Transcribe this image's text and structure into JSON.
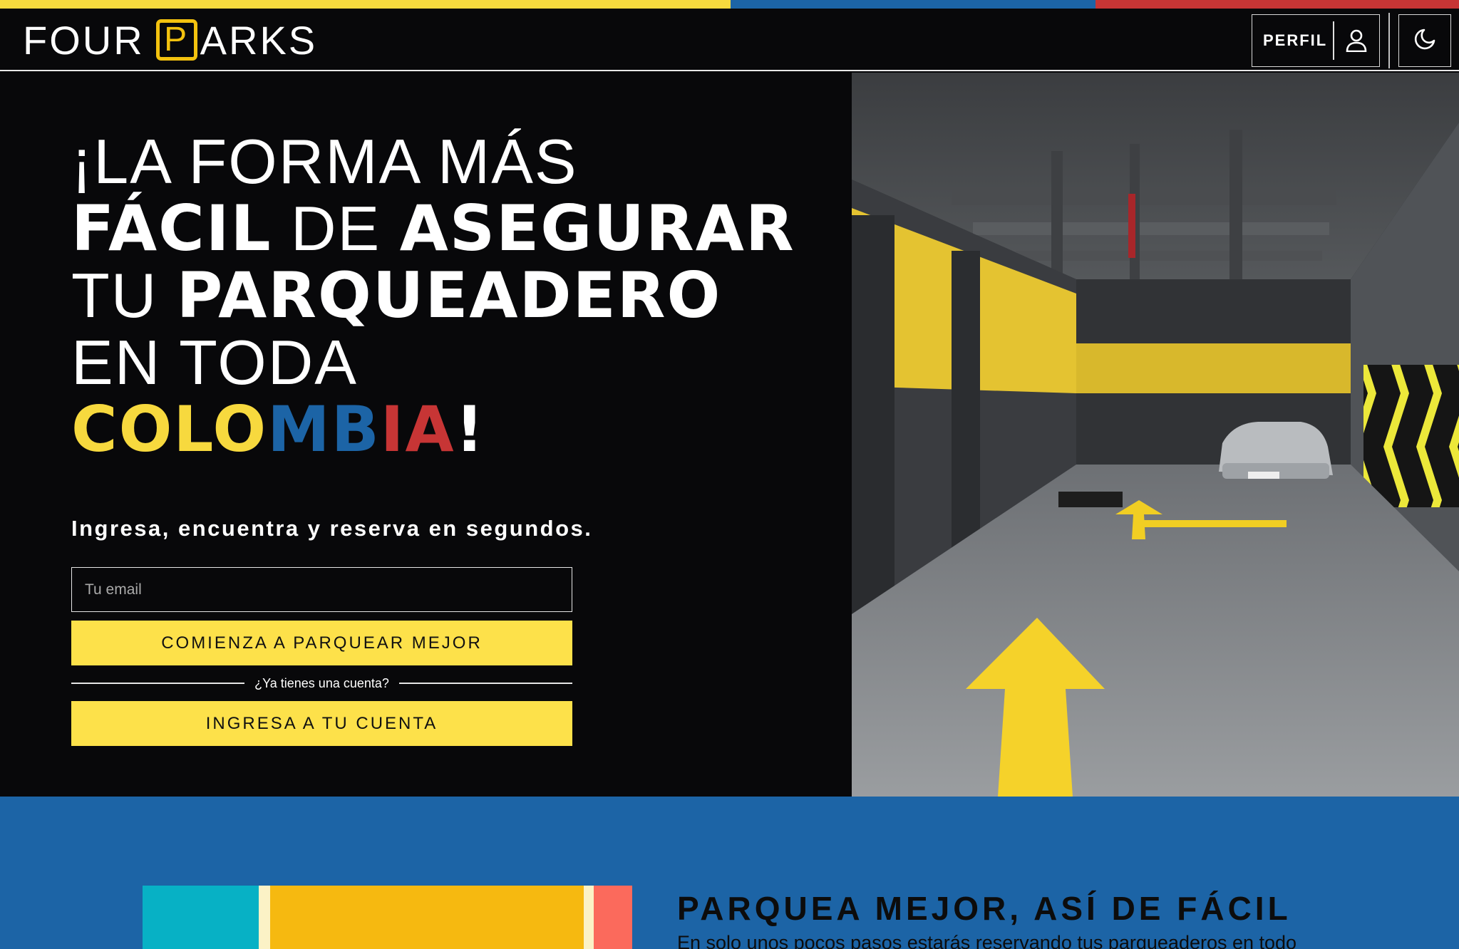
{
  "brand": {
    "logo_left": "FOUR",
    "logo_p": "P",
    "logo_right": "ARKS",
    "colors": {
      "yellow": "#f7d93e",
      "blue": "#1c64a6",
      "red": "#c73535",
      "background": "#08080a",
      "button": "#fde14a"
    }
  },
  "header": {
    "profile_label": "PERFIL",
    "profile_icon": "user-icon",
    "theme_icon": "moon-icon"
  },
  "hero": {
    "line1": "¡LA FORMA MÁS",
    "line2_bold1": "FÁCIL",
    "line2_light": " DE ",
    "line2_bold2": "ASEGURAR",
    "line3_light": "TU ",
    "line3_bold": "PARQUEADERO",
    "line4": "EN TODA",
    "colombia_yellow": "COLO",
    "colombia_blue": "MB",
    "colombia_red": "IA",
    "exclaim": "!",
    "subtitle": "Ingresa, encuentra y reserva en segundos.",
    "email_placeholder": "Tu email",
    "start_button": "COMIENZA A PARQUEAR MEJOR",
    "account_question": "¿Ya tienes una cuenta?",
    "login_button": "INGRESA A TU CUENTA"
  },
  "features": {
    "title": "PARQUEA MEJOR, ASÍ DE FÁCIL",
    "text": "En solo unos pocos pasos estarás reservando tus parqueaderos en todo"
  }
}
